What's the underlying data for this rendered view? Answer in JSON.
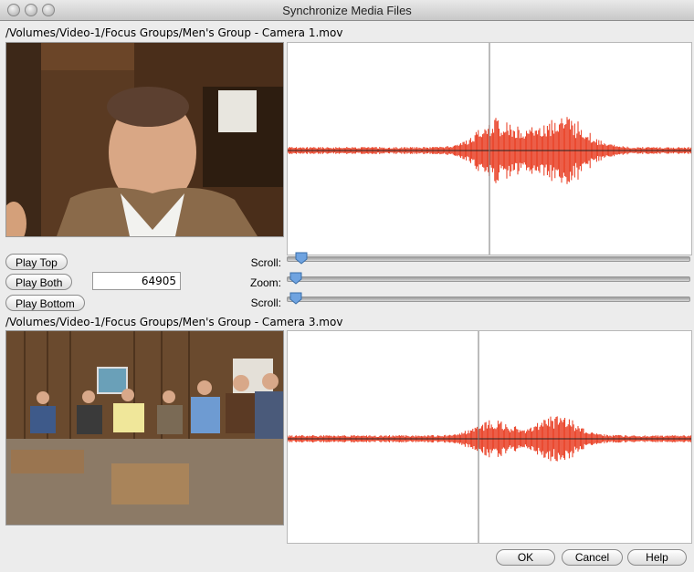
{
  "window": {
    "title": "Synchronize Media Files"
  },
  "top": {
    "path": "/Volumes/Video-1/Focus Groups/Men's Group - Camera 1.mov"
  },
  "bottom": {
    "path": "/Volumes/Video-1/Focus Groups/Men's Group - Camera 3.mov"
  },
  "controls": {
    "play_top": "Play Top",
    "play_both": "Play Both",
    "play_bottom": "Play Bottom",
    "offset_value": "64905",
    "scroll_top_label": "Scroll:",
    "zoom_label": "Zoom:",
    "scroll_bottom_label": "Scroll:"
  },
  "buttons": {
    "ok": "OK",
    "cancel": "Cancel",
    "help": "Help"
  },
  "colors": {
    "waveform": "#e8361a"
  }
}
